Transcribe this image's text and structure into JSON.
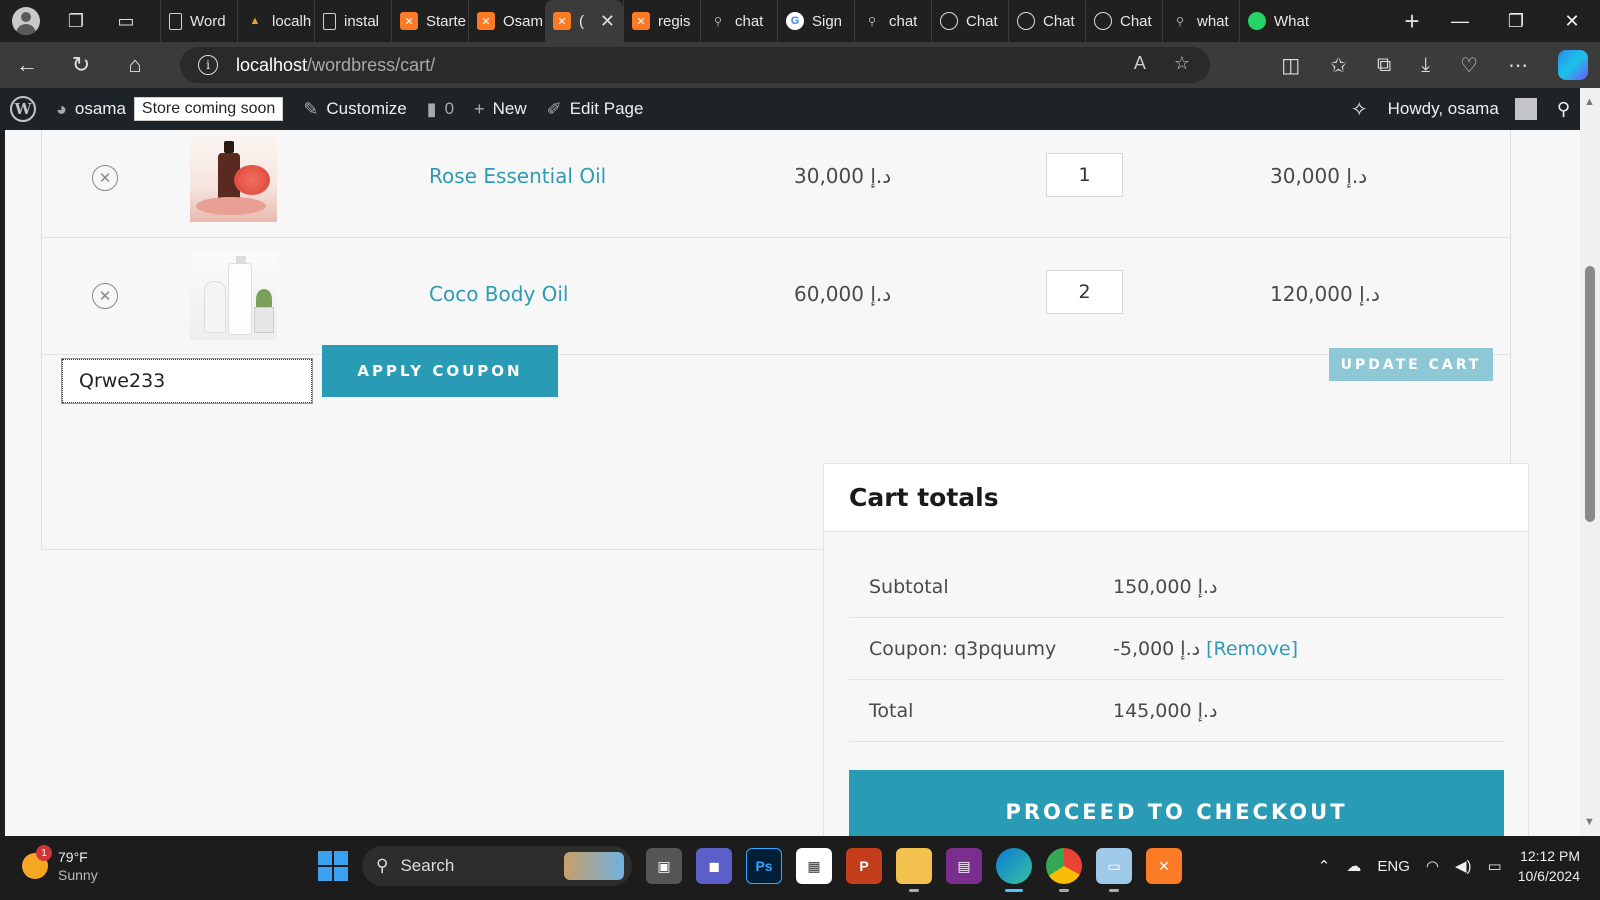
{
  "browser": {
    "tabs": [
      {
        "label": "Word",
        "favicon": "doc"
      },
      {
        "label": "localh",
        "favicon": "tri"
      },
      {
        "label": "instal",
        "favicon": "doc"
      },
      {
        "label": "Starte",
        "favicon": "xampp"
      },
      {
        "label": "Osam",
        "favicon": "xampp"
      },
      {
        "label": "(",
        "favicon": "xampp",
        "active": true
      },
      {
        "label": "regis",
        "favicon": "xampp"
      },
      {
        "label": "chat",
        "favicon": "search"
      },
      {
        "label": "Sign",
        "favicon": "g"
      },
      {
        "label": "chat",
        "favicon": "search"
      },
      {
        "label": "Chat",
        "favicon": "ai"
      },
      {
        "label": "Chat",
        "favicon": "ai"
      },
      {
        "label": "Chat",
        "favicon": "ai"
      },
      {
        "label": "what",
        "favicon": "search"
      },
      {
        "label": "What",
        "favicon": "wa"
      }
    ],
    "url_host": "localhost",
    "url_path": "/wordbress/cart/"
  },
  "wpbar": {
    "site_name": "osama",
    "store_badge": "Store coming soon",
    "customize": "Customize",
    "comments_count": "0",
    "new_label": "New",
    "edit_page": "Edit Page",
    "howdy": "Howdy, osama"
  },
  "cart": {
    "currency": "د.إ",
    "items": [
      {
        "name": "Rose Essential Oil",
        "price": "30,000",
        "qty": "1",
        "subtotal": "30,000"
      },
      {
        "name": "Coco Body Oil",
        "price": "60,000",
        "qty": "2",
        "subtotal": "120,000"
      }
    ],
    "coupon_value": "Qrwe233",
    "apply_label": "APPLY COUPON",
    "update_label": "UPDATE CART"
  },
  "totals": {
    "heading": "Cart totals",
    "subtotal_label": "Subtotal",
    "subtotal_value": "150,000",
    "coupon_label": "Coupon: q3pquumy",
    "coupon_value": "-5,000",
    "remove_label": "[Remove]",
    "total_label": "Total",
    "total_value": "145,000",
    "checkout_label": "PROCEED TO CHECKOUT"
  },
  "taskbar": {
    "temperature": "79°F",
    "condition": "Sunny",
    "notification_count": "1",
    "search_label": "Search",
    "language": "ENG",
    "time": "12:12 PM",
    "date": "10/6/2024"
  }
}
